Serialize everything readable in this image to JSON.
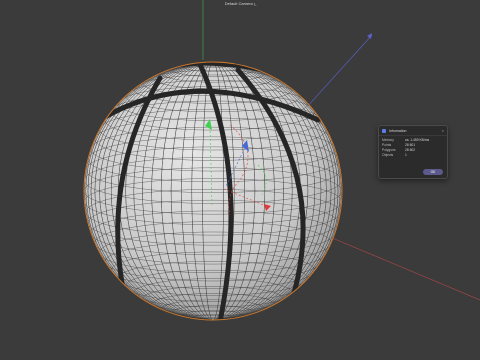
{
  "viewport": {
    "camera_label": "Default Camera •̲",
    "background": "#3b3b3b",
    "mesh_color": "#d9d9d9",
    "wire_color": "#3a3a3a",
    "selection_outline": "#c8772e",
    "axis_colors": {
      "x": "#e03a3a",
      "y": "#3fd14f",
      "z": "#3b6de0"
    }
  },
  "info_dialog": {
    "title": "Information",
    "rows": [
      {
        "label": "Memory",
        "value": "ca. 1.459 KB/ms"
      },
      {
        "label": "Points",
        "value": "28 601"
      },
      {
        "label": "Polygons",
        "value": "28 602"
      },
      {
        "label": "Objects",
        "value": "1"
      }
    ],
    "ok_label": "OK",
    "accent": "#5b7de8"
  }
}
